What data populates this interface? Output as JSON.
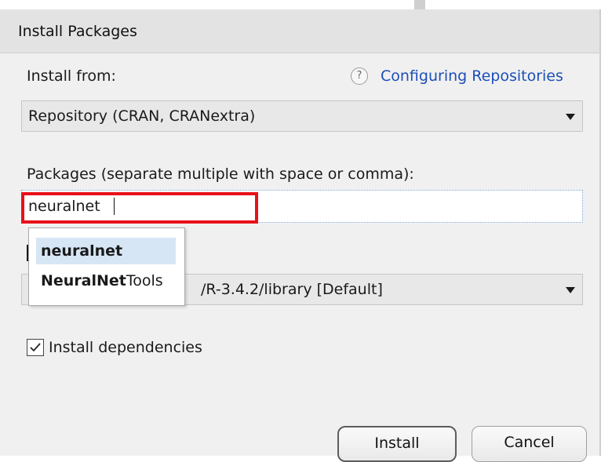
{
  "dialog": {
    "title": "Install Packages"
  },
  "install_from": {
    "label": "Install from:",
    "help_icon": "question-icon",
    "help_glyph": "?",
    "help_link": "Configuring Repositories",
    "selected": "Repository (CRAN, CRANextra)"
  },
  "packages": {
    "label": "Packages (separate multiple with space or comma):",
    "value": "neuralnet"
  },
  "autocomplete": {
    "items": [
      {
        "bold": "neuralnet",
        "rest": ""
      },
      {
        "bold": "NeuralNet",
        "rest": "Tools"
      }
    ]
  },
  "library": {
    "selected_visible": "/R-3.4.2/library [Default]"
  },
  "dependencies": {
    "label": "Install dependencies",
    "checked": true
  },
  "buttons": {
    "install": "Install",
    "cancel": "Cancel"
  },
  "colors": {
    "highlight": "#e8101a",
    "link": "#1c4fb8",
    "selection": "#d6e6f5"
  }
}
